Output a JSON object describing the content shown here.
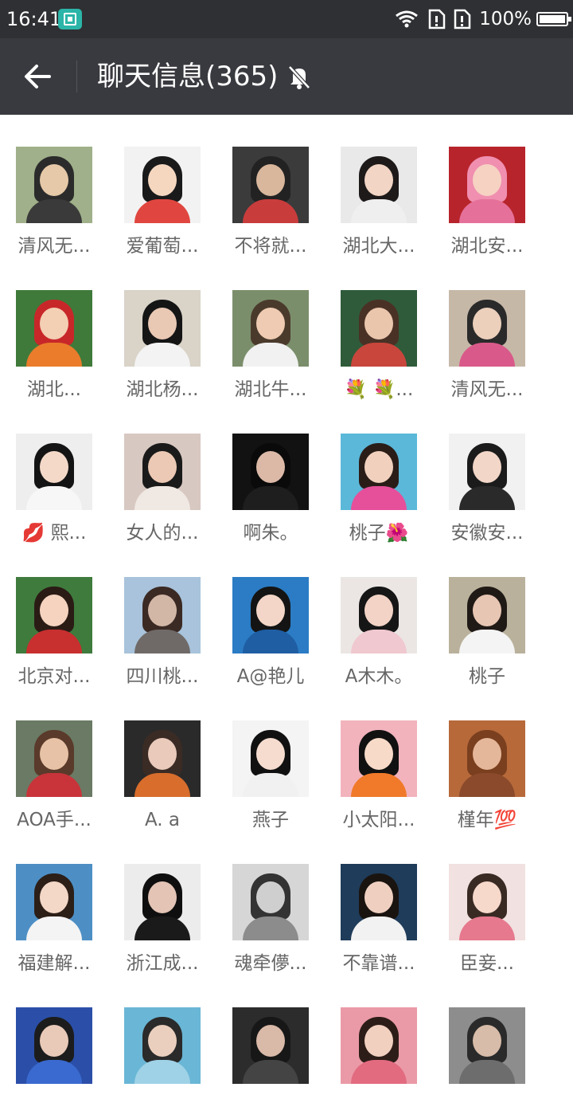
{
  "status_bar": {
    "time": "16:41",
    "battery_percent": "100%",
    "battery_level": 1.0,
    "icons": [
      "screenshot-app-icon",
      "wifi-icon",
      "sim-card-icon",
      "sim-card-icon",
      "battery-icon"
    ]
  },
  "header": {
    "back_icon": "arrow-left-icon",
    "title": "聊天信息(365)",
    "mute_icon": "bell-off-icon"
  },
  "colors": {
    "status_bar_bg": "#2f3033",
    "title_bar_bg": "#393a3f",
    "name_text": "#666666",
    "page_bg": "#ffffff"
  },
  "members": [
    {
      "name": "清风无...",
      "avatar_palette": [
        "#9fb08a",
        "#2b2b2b",
        "#e6c9a8",
        "#3a3a3a"
      ]
    },
    {
      "name": "爱葡萄...",
      "avatar_palette": [
        "#f2f2f2",
        "#1a1a1a",
        "#f5d7c0",
        "#e0463f"
      ]
    },
    {
      "name": "不将就...",
      "avatar_palette": [
        "#3b3b3b",
        "#222222",
        "#d9b79c",
        "#c93c3c"
      ]
    },
    {
      "name": "湖北大...",
      "avatar_palette": [
        "#e9e9ea",
        "#1e1a1a",
        "#f2d5c4",
        "#efefef"
      ]
    },
    {
      "name": "湖北安...",
      "avatar_palette": [
        "#b8242c",
        "#f08fb0",
        "#f6d2c2",
        "#e5719a"
      ]
    },
    {
      "name": "湖北...",
      "avatar_palette": [
        "#3f7a3a",
        "#c8272a",
        "#f3cfb3",
        "#ea7c2c"
      ]
    },
    {
      "name": "湖北杨...",
      "avatar_palette": [
        "#d9d3c8",
        "#151515",
        "#e9c8b4",
        "#f3f3f3"
      ]
    },
    {
      "name": "湖北牛...",
      "avatar_palette": [
        "#7b8e6b",
        "#4a3a2c",
        "#eecbb2",
        "#f1f1f1"
      ]
    },
    {
      "name": "💐 💐...",
      "avatar_palette": [
        "#2f5b3a",
        "#4a3125",
        "#eac6ad",
        "#c8463c"
      ]
    },
    {
      "name": "清风无...",
      "avatar_palette": [
        "#c6b8a7",
        "#2a2a2a",
        "#ecd0bc",
        "#d95a8a"
      ]
    },
    {
      "name": "💋 熙...",
      "avatar_palette": [
        "#eeeeee",
        "#141414",
        "#f4d9c9",
        "#f7f7f7"
      ]
    },
    {
      "name": "女人的...",
      "avatar_palette": [
        "#d8c8c2",
        "#1a1a1a",
        "#ecc9b4",
        "#f0e8e3"
      ]
    },
    {
      "name": "啊朱。",
      "avatar_palette": [
        "#121212",
        "#0a0a0a",
        "#dcb9a7",
        "#1e1e1e"
      ]
    },
    {
      "name": "桃子🌺",
      "avatar_palette": [
        "#5bb8d9",
        "#2a1d18",
        "#f1d0bd",
        "#e64f9a"
      ]
    },
    {
      "name": "安徽安...",
      "avatar_palette": [
        "#f1f1f1",
        "#1b1b1b",
        "#f2d6c8",
        "#2a2a2a"
      ]
    },
    {
      "name": "北京对...",
      "avatar_palette": [
        "#3f7b3d",
        "#2b1b15",
        "#f5d3bf",
        "#c82f2f"
      ]
    },
    {
      "name": "四川桃...",
      "avatar_palette": [
        "#a8c3db",
        "#3b2a24",
        "#d3b7a6",
        "#6f6a68"
      ]
    },
    {
      "name": "A@艳儿",
      "avatar_palette": [
        "#2b7cc4",
        "#141414",
        "#f3d6c7",
        "#1f5ea3"
      ]
    },
    {
      "name": "A木木。",
      "avatar_palette": [
        "#ebe6e4",
        "#161616",
        "#f3d3c6",
        "#f0c8cf"
      ]
    },
    {
      "name": "桃子",
      "avatar_palette": [
        "#b9b19b",
        "#201a16",
        "#e7c6b3",
        "#f4f4f4"
      ]
    },
    {
      "name": "AOA手...",
      "avatar_palette": [
        "#6a7a64",
        "#5a3a2a",
        "#e7c2a6",
        "#c8343a"
      ]
    },
    {
      "name": "A. a",
      "avatar_palette": [
        "#2a2a2a",
        "#3b2b25",
        "#e9cabb",
        "#d86d2c"
      ]
    },
    {
      "name": "燕子",
      "avatar_palette": [
        "#f4f4f4",
        "#111111",
        "#f5dccf",
        "#f1f1f1"
      ]
    },
    {
      "name": "小太阳...",
      "avatar_palette": [
        "#f2b3bd",
        "#111111",
        "#f7dac8",
        "#f07a2a"
      ]
    },
    {
      "name": "槿年💯",
      "avatar_palette": [
        "#b7693a",
        "#7a3f1e",
        "#e5b79a",
        "#8a4a2b"
      ]
    },
    {
      "name": "福建解...",
      "avatar_palette": [
        "#4d8fc5",
        "#2c1f18",
        "#f4d8c7",
        "#f4f4f4"
      ]
    },
    {
      "name": "浙江成...",
      "avatar_palette": [
        "#ececec",
        "#0f0f0f",
        "#e3c4b5",
        "#1a1a1a"
      ]
    },
    {
      "name": "魂牵儚...",
      "avatar_palette": [
        "#d6d6d6",
        "#333333",
        "#cfcfcf",
        "#8c8c8c"
      ]
    },
    {
      "name": "不靠谱...",
      "avatar_palette": [
        "#1f3c5a",
        "#1a1410",
        "#efd0c0",
        "#f2f2f2"
      ]
    },
    {
      "name": "臣妾...",
      "avatar_palette": [
        "#f1e1e0",
        "#3a2a24",
        "#f7d9cc",
        "#e6798e"
      ]
    },
    {
      "name": "",
      "avatar_palette": [
        "#2b4fa8",
        "#1c1c1c",
        "#e9c9b8",
        "#3a6ad0"
      ]
    },
    {
      "name": "",
      "avatar_palette": [
        "#6ab6d6",
        "#2a2a2a",
        "#eacfbe",
        "#9fd2e6"
      ]
    },
    {
      "name": "",
      "avatar_palette": [
        "#2c2c2c",
        "#171717",
        "#d9b9a8",
        "#444444"
      ]
    },
    {
      "name": "",
      "avatar_palette": [
        "#ea9aa6",
        "#2d1d18",
        "#f2d0c0",
        "#e26b80"
      ]
    },
    {
      "name": "",
      "avatar_palette": [
        "#8d8d8d",
        "#2a2a2a",
        "#d7bca9",
        "#6d6d6d"
      ]
    }
  ]
}
